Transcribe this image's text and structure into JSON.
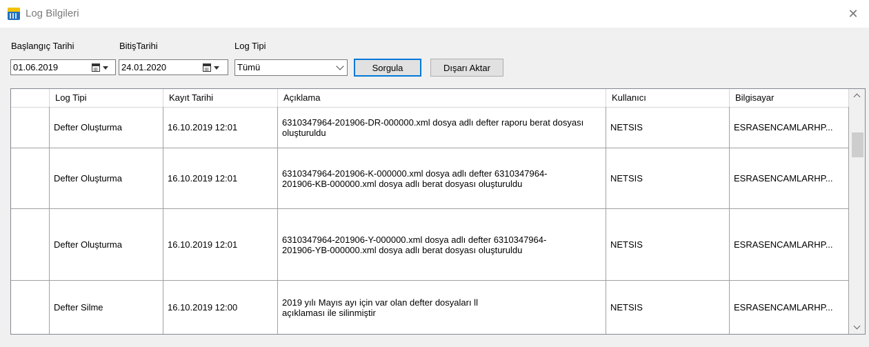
{
  "window": {
    "title": "Log Bilgileri"
  },
  "filters": {
    "start_label": "Başlangıç Tarihi",
    "start_value": "01.06.2019",
    "end_label": "BitişTarihi",
    "end_value": "24.01.2020",
    "type_label": "Log Tipi",
    "type_value": "Tümü",
    "query_button": "Sorgula",
    "export_button": "Dışarı Aktar"
  },
  "table": {
    "columns": [
      "Log Tipi",
      "Kayıt Tarihi",
      "Açıklama",
      "Kullanıcı",
      "Bilgisayar"
    ],
    "rows": [
      {
        "log_type": "Defter Oluşturma",
        "date": "16.10.2019 12:01",
        "description": "6310347964-201906-DR-000000.xml dosya adlı defter raporu berat dosyası oluşturuldu",
        "user": "NETSIS",
        "computer": "ESRASENCAMLARHP..."
      },
      {
        "log_type": "Defter Oluşturma",
        "date": "16.10.2019 12:01",
        "description": "6310347964-201906-K-000000.xml dosya adlı defter 6310347964-201906-KB-000000.xml dosya adlı berat dosyası oluşturuldu",
        "user": "NETSIS",
        "computer": "ESRASENCAMLARHP..."
      },
      {
        "log_type": "Defter Oluşturma",
        "date": "16.10.2019 12:01",
        "description": "6310347964-201906-Y-000000.xml dosya adlı defter 6310347964-201906-YB-000000.xml dosya adlı berat dosyası oluşturuldu",
        "user": "NETSIS",
        "computer": "ESRASENCAMLARHP..."
      },
      {
        "log_type": "Defter Silme",
        "date": "16.10.2019 12:00",
        "description": "2019 yılı Mayıs ayı için var olan defter dosyaları ll açıklaması ile silinmiştir",
        "user": "NETSIS",
        "computer": "ESRASENCAMLARHP..."
      }
    ]
  }
}
